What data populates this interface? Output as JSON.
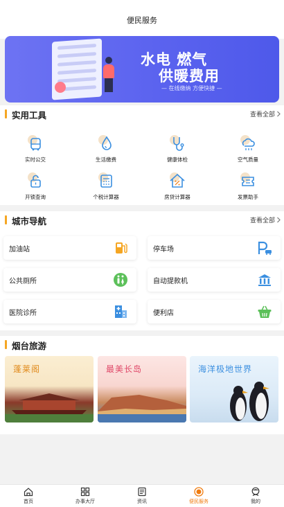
{
  "header": {
    "title": "便民服务"
  },
  "banner": {
    "line1": "水电 燃气",
    "line2": "供暖费用",
    "line3": "— 在线缴纳 方便快捷 —"
  },
  "tools_section": {
    "title": "实用工具",
    "more": "查看全部",
    "items": [
      {
        "label": "实时公交",
        "icon": "bus-icon"
      },
      {
        "label": "生活缴费",
        "icon": "water-drop-icon"
      },
      {
        "label": "健康体检",
        "icon": "stethoscope-icon"
      },
      {
        "label": "空气质量",
        "icon": "cloud-icon"
      },
      {
        "label": "开锁查询",
        "icon": "lock-icon"
      },
      {
        "label": "个税计算器",
        "icon": "calculator-icon"
      },
      {
        "label": "房贷计算器",
        "icon": "house-percent-icon"
      },
      {
        "label": "发票助手",
        "icon": "ticket-icon"
      }
    ]
  },
  "city_section": {
    "title": "城市导航",
    "more": "查看全部",
    "items": [
      {
        "label": "加油站",
        "icon": "fuel-pump-icon"
      },
      {
        "label": "停车场",
        "icon": "parking-icon"
      },
      {
        "label": "公共厕所",
        "icon": "restroom-icon"
      },
      {
        "label": "自动提款机",
        "icon": "bank-icon"
      },
      {
        "label": "医院诊所",
        "icon": "hospital-icon"
      },
      {
        "label": "便利店",
        "icon": "basket-icon"
      }
    ]
  },
  "tour_section": {
    "title": "烟台旅游",
    "items": [
      {
        "label": "蓬莱阁"
      },
      {
        "label": "最美长岛"
      },
      {
        "label": "海洋极地世界"
      }
    ]
  },
  "tabbar": {
    "items": [
      {
        "label": "首页",
        "icon": "home-icon"
      },
      {
        "label": "办事大厅",
        "icon": "grid-icon"
      },
      {
        "label": "资讯",
        "icon": "news-icon"
      },
      {
        "label": "便民服务",
        "icon": "service-icon",
        "active": true
      },
      {
        "label": "我的",
        "icon": "user-icon"
      }
    ]
  },
  "colors": {
    "accent": "#f07c10",
    "section_bar": "#f5a623",
    "icon_blue": "#3b8fe0",
    "banner": "#5b63ef"
  }
}
